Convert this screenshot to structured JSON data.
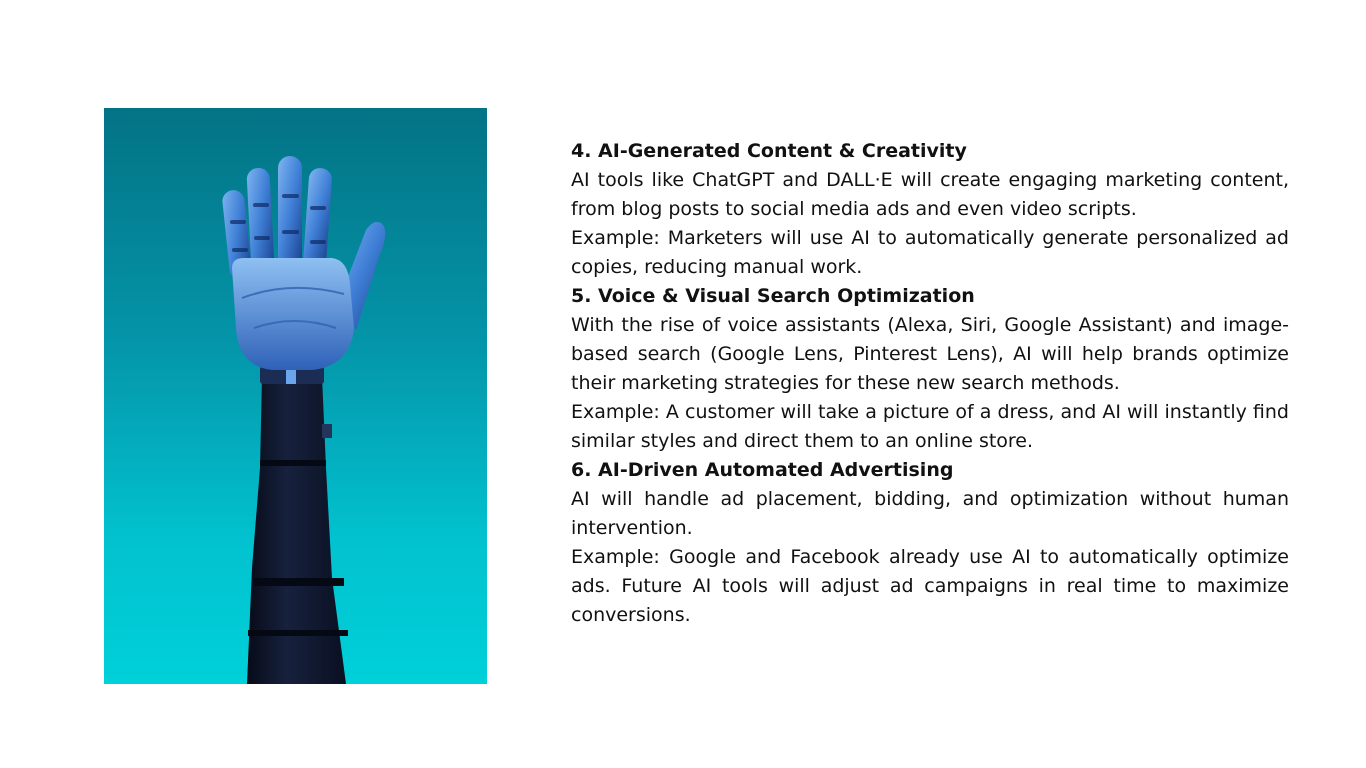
{
  "slide": {
    "image": {
      "subject": "robotic-hand-raised",
      "colors": {
        "bg_top": "#037385",
        "bg_bottom": "#00d0d9",
        "hand": "#3f7fd6",
        "arm": "#0c1428"
      }
    },
    "sections": [
      {
        "heading": "4. AI-Generated Content & Creativity",
        "paragraphs": [
          "AI tools like ChatGPT and DALL·E will create engaging marketing content, from blog posts to social media ads and even video scripts.",
          "Example: Marketers will use AI to automatically generate personalized ad copies, reducing manual work."
        ]
      },
      {
        "heading": "5. Voice & Visual Search Optimization",
        "paragraphs": [
          "With the rise of voice assistants (Alexa, Siri, Google Assistant) and image-based search (Google Lens, Pinterest Lens), AI will help brands optimize their marketing strategies for these new search methods.",
          "Example: A customer will take a picture of a dress, and AI will instantly find similar styles and direct them to an online store."
        ]
      },
      {
        "heading": "6. AI-Driven Automated Advertising",
        "paragraphs": [
          "AI will handle ad placement, bidding, and optimization without human intervention.",
          "Example: Google and Facebook already use AI to automatically optimize ads. Future AI tools will adjust ad campaigns in real time to maximize conversions."
        ]
      }
    ]
  }
}
